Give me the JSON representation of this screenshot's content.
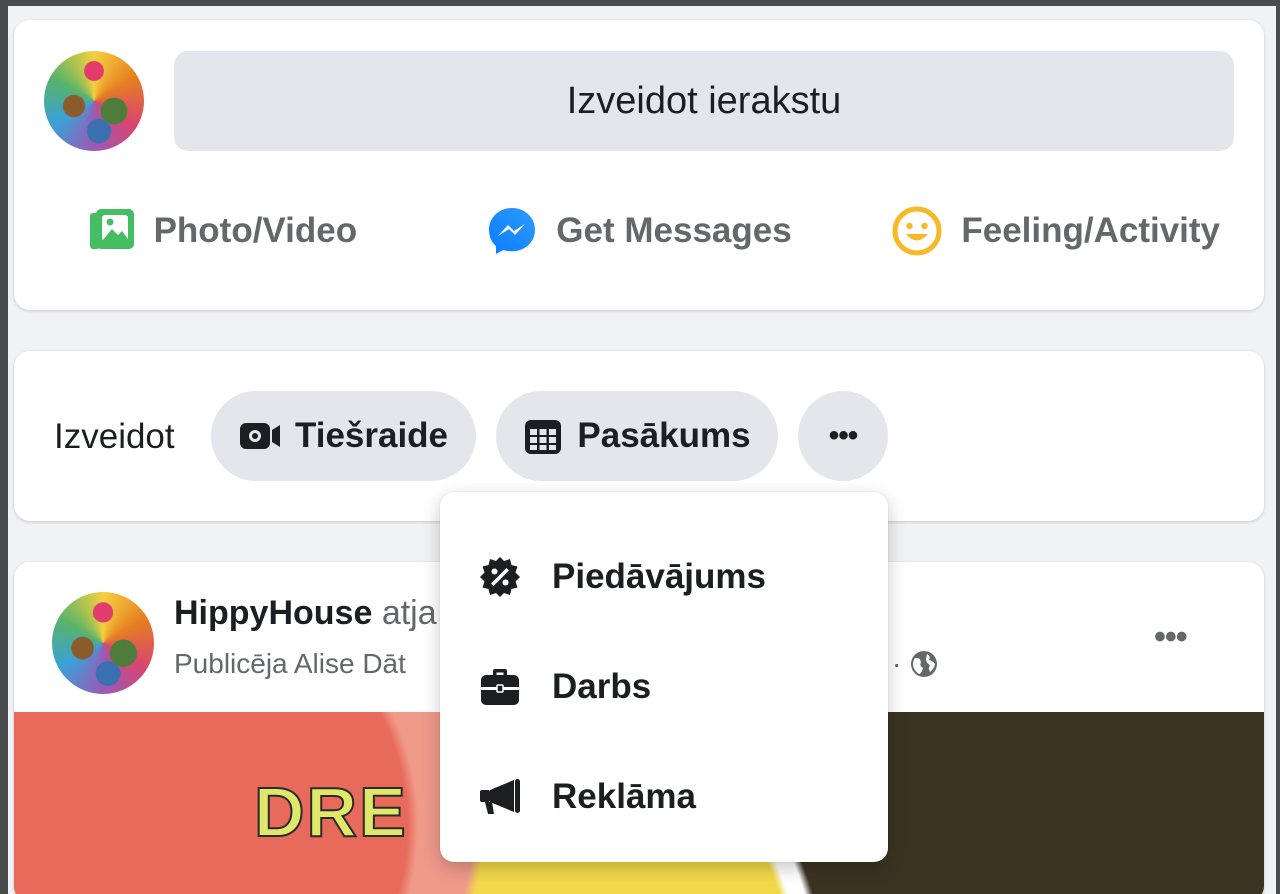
{
  "composer": {
    "placeholder": "Izveidot ierakstu",
    "actions": [
      {
        "label": "Photo/Video",
        "icon": "photo-video-icon",
        "color": "#45bd62"
      },
      {
        "label": "Get Messages",
        "icon": "messenger-icon",
        "color": "#1877f2"
      },
      {
        "label": "Feeling/Activity",
        "icon": "feeling-icon",
        "color": "#f7b928"
      }
    ]
  },
  "create": {
    "label": "Izveidot",
    "buttons": [
      {
        "label": "Tiešraide",
        "icon": "live-video-icon"
      },
      {
        "label": "Pasākums",
        "icon": "calendar-icon"
      },
      {
        "label": "•••",
        "icon": "more-icon"
      }
    ]
  },
  "dropdown": {
    "items": [
      {
        "label": "Piedāvājums",
        "icon": "offer-percent-icon"
      },
      {
        "label": "Darbs",
        "icon": "briefcase-icon"
      },
      {
        "label": "Reklāma",
        "icon": "megaphone-icon"
      }
    ]
  },
  "post": {
    "author": "HippyHouse",
    "action_partial": "atja",
    "subtitle_partial": "Publicēja Alise Dāt",
    "privacy_separator": "·",
    "more": "•••",
    "image_text": "DRE"
  }
}
